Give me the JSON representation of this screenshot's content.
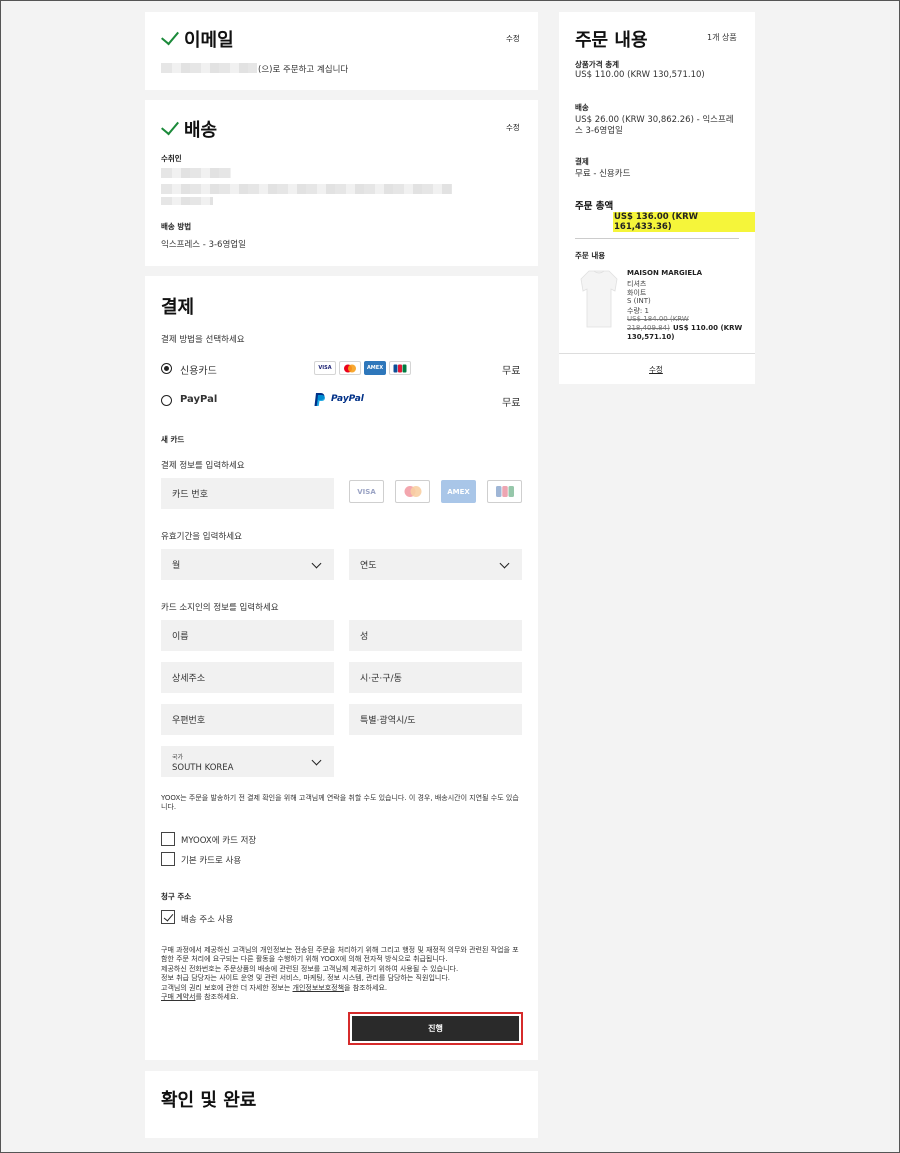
{
  "email_section": {
    "title": "이메일",
    "edit": "수정",
    "ordering_as": "(으)로 주문하고 계십니다"
  },
  "shipping_section": {
    "title": "배송",
    "edit": "수정",
    "recipient_label": "수취인",
    "method_label": "배송 방법",
    "method_value": "익스프레스 - 3-6영업일"
  },
  "payment_section": {
    "title": "결제",
    "select_method": "결제 방법을 선택하세요",
    "methods": [
      {
        "label": "신용카드",
        "price": "무료",
        "selected": true
      },
      {
        "label": "PayPal",
        "price": "무료",
        "selected": false
      }
    ],
    "card_brands": [
      "VISA",
      "MC",
      "AMEX",
      "JCB"
    ],
    "paypal_logo": "PayPal",
    "new_card_label": "새 카드",
    "enter_card_info": "결제 정보를 입력하세요",
    "card_number_placeholder": "카드 번호",
    "enter_expiry": "유효기간을 입력하세요",
    "month_placeholder": "월",
    "year_placeholder": "연도",
    "enter_holder_info": "카드 소지인의 정보를 입력하세요",
    "first_name": "이름",
    "last_name": "성",
    "address_detail": "상세주소",
    "city": "시·군·구/동",
    "zip": "우편번호",
    "province": "특별·광역시/도",
    "country_label": "국가",
    "country_value": "SOUTH KOREA",
    "notice": "YOOX는 주문을 발송하기 전 결제 확인을 위해 고객님께 연락을 취할 수도 있습니다. 이 경우, 배송시간이 지연될 수도 있습니다.",
    "save_card": "MYOOX에 카드 저장",
    "default_card": "기본 카드로 사용",
    "billing_label": "청구 주소",
    "use_shipping_address": "배송 주소 사용",
    "legal_1": "구매 과정에서 제공하신 고객님의 개인정보는 전송된 주문을 처리하기 위해 그리고 행정 및 재정적 의무와 관련된 작업을 포함한 주문 처리에 요구되는 다른 활동을 수행하기 위해 YOOX에 의해 전자적 방식으로 취급됩니다.",
    "legal_2": "제공하신 전화번호는 주문상품의 배송에 관련된 정보를 고객님께 제공하기 위하여 사용될 수 있습니다.",
    "legal_3": "정보 취급 담당자는 사이트 운영 및 관련 서비스, 마케팅, 정보 시스템, 관리를 담당하는 직원입니다.",
    "legal_4a": "고객님의 권리 보호에 관한 더 자세한 정보는 ",
    "legal_4_link": "개인정보보호정책",
    "legal_4b": "을 참조하세요.",
    "legal_5_link": "구매 계약서",
    "legal_5b": "를 참조하세요.",
    "proceed": "진행"
  },
  "confirm_section": {
    "title": "확인 및 완료"
  },
  "summary": {
    "title": "주문 내용",
    "item_count": "1개 상품",
    "subtotal_label": "상품가격 총계",
    "subtotal_value": "US$ 110.00 (KRW 130,571.10)",
    "shipping_label": "배송",
    "shipping_value_1": "US$ 26.00 (KRW 30,862.26) - 익스프레",
    "shipping_value_2": "스 3-6영업일",
    "payment_label": "결제",
    "payment_value": "무료 - 신용카드",
    "total_label": "주문 총액",
    "total_value": "US$ 136.00 (KRW 161,433.36)",
    "items_label": "주문 내용",
    "item": {
      "brand": "MAISON MARGIELA",
      "category": "티셔츠",
      "color": "화이트",
      "size": "S (INT)",
      "qty": "수량: 1",
      "old_price_1": "US$ 184.00 (KRW",
      "old_price_2": "218,409.84)",
      "new_price_1": "US$ 110.00 (KRW",
      "new_price_2": "130,571.10)"
    },
    "edit": "수정"
  },
  "colors": {
    "check": "#1b8a3a",
    "highlight": "#f5f53a",
    "button": "#2a2a2a",
    "outline": "#d62b2b",
    "visa": "#1a1f71",
    "paypal": "#003087"
  }
}
